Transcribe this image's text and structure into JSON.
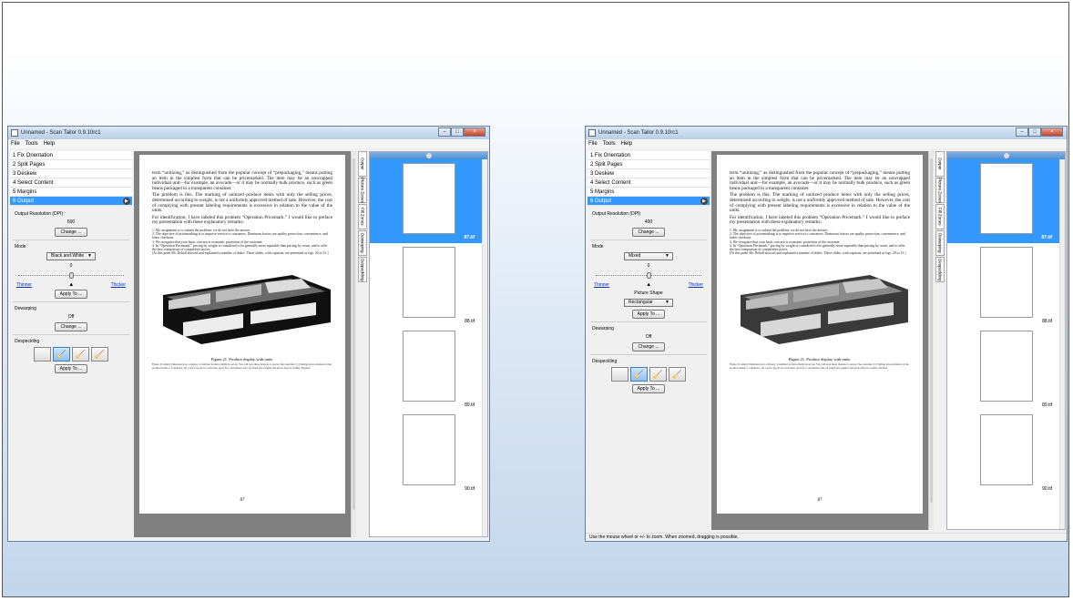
{
  "windows": [
    {
      "title": "Unnamed - Scan Tailor 0.9.10rc1",
      "menu": [
        "File",
        "Tools",
        "Help"
      ],
      "stages": [
        "1 Fix Orientation",
        "2 Split Pages",
        "3 Deskew",
        "4 Select Content",
        "5 Margins",
        "6 Output"
      ],
      "output_resolution_label": "Output Resolution (DPI)",
      "dpi": "600",
      "change_label": "Change ...",
      "mode_label": "Mode",
      "mode_value": "Black and White",
      "threshold": "0",
      "thinner": "Thinner",
      "thicker": "Thicker",
      "apply_label": "Apply To ...",
      "picture_shape_label": "",
      "picture_shape_value": "",
      "dewarping_label": "Dewarping",
      "dewarping_value": "Off",
      "despeckling_label": "Despeckling",
      "tabs": [
        "Output",
        "Picture Zones",
        "Fill Zones",
        "Dewarping",
        "Despeckling"
      ],
      "thumbnails": [
        "87.tif",
        "88.tif",
        "89.tif",
        "90.tif"
      ],
      "status": ""
    },
    {
      "title": "Unnamed - Scan Tailor 0.9.10rc1",
      "menu": [
        "File",
        "Tools",
        "Help"
      ],
      "stages": [
        "1 Fix Orientation",
        "2 Split Pages",
        "3 Deskew",
        "4 Select Content",
        "5 Margins",
        "6 Output"
      ],
      "output_resolution_label": "Output Resolution (DPI)",
      "dpi": "400",
      "change_label": "Change ...",
      "mode_label": "Mode",
      "mode_value": "Mixed",
      "threshold": "0",
      "thinner": "Thinner",
      "thicker": "Thicker",
      "apply_label": "Apply To ...",
      "picture_shape_label": "Picture Shape",
      "picture_shape_value": "Rectangular",
      "dewarping_label": "Dewarping",
      "dewarping_value": "Off",
      "despeckling_label": "Despeckling",
      "tabs": [
        "Output",
        "Picture Zones",
        "Fill Zones",
        "Dewarping",
        "Despeckling"
      ],
      "thumbnails": [
        "87.tif",
        "88.tif",
        "89.tif",
        "90.tif"
      ],
      "status": "Use the mouse wheel or +/- to zoom.  When zoomed, dragging is possible."
    }
  ],
  "page": {
    "paragraphs": [
      "term “unitizing,” as distinguished from the popular concept of “prepackaging,” means putting an item in the simplest form that can be pricemarked. The item may be an unwrapped individual unit—for example, an avocado—or it may be normally bulk produce, such as green beans packaged in a transparent container.",
      "The problem is this. The marking of unitized produce items with only the selling prices, determined according to weight, is not a uniformly approved method of sale. However, the cost of complying with present labeling requirements is excessive in relation to the value of the units.",
      "For identification, I have labeled this problem “Operation Pricemark.” I would like to preface my presentation with these explanatory remarks:"
    ],
    "list": [
      "1. My assignment is to submit the problem; we do not have the answer.",
      "2. The objective of pricemarking is to improve service to customers. Dominant factors are quality protection, convenience, and faster checkout.",
      "3. We recognize that your basic concern is economic protection of the customer.",
      "4. In “Operation Pricemark,” pricing by weight is considered to be generally more equitable than pricing by count, and to offer the best comparison of competitive prices.",
      "[At this point Mr. Deboll showed and explained a number of slides. These slides, with captions, are presented as figs. 20 to 31.]"
    ],
    "caption": "Figure 21.  Produce display with units.",
    "caption_detail": "Figure 21 simply illustrates how a display of unitized produce might be set up. You will note these features to protect the customer: (1) Selling prices marked on the produce items or containers, (2) a price tag above each item, and (3) a convenient scale on which net weights and prices may be readily checked.",
    "number": "87"
  }
}
